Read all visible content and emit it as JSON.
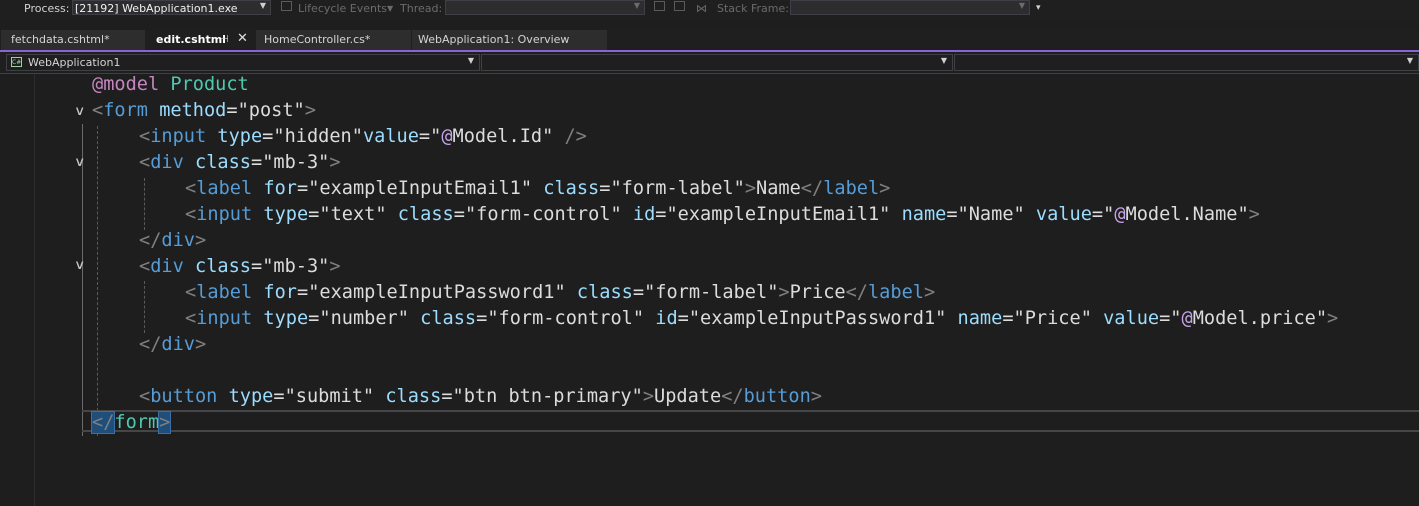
{
  "debug_toolbar": {
    "process_label": "Process:",
    "process_value": "[21192] WebApplication1.exe",
    "lifecycle_label": "Lifecycle Events",
    "thread_label": "Thread:",
    "stack_frame_label": "Stack Frame:"
  },
  "tabs": [
    {
      "label": "fetchdata.cshtml*",
      "active": false
    },
    {
      "label": "edit.cshtml",
      "active": true
    },
    {
      "label": "HomeController.cs*",
      "active": false
    },
    {
      "label": "WebApplication1: Overview",
      "active": false
    }
  ],
  "navbar": {
    "project": "WebApplication1",
    "project_icon": "csharp-project-icon"
  },
  "code": {
    "l1": {
      "dir": "@model",
      "type": "Product"
    },
    "l2": {
      "open": "<",
      "tag": "form",
      "attr": "method",
      "eq": "=",
      "val": "\"post\"",
      "close": ">"
    },
    "l3": {
      "open": "<",
      "tag": "input",
      "a1": "type",
      "eq1": "=",
      "v1": "\"hidden\"",
      "a2": "value",
      "eq2": "=",
      "q": "\"",
      "at": "@",
      "expr": "Model.Id",
      "q2": "\"",
      "close": " />"
    },
    "l4": {
      "open": "<",
      "tag": "div",
      "attr": "class",
      "eq": "=",
      "val": "\"mb-3\"",
      "close": ">"
    },
    "l5": {
      "open": "<",
      "tag": "label",
      "a1": "for",
      "eq1": "=",
      "v1": "\"exampleInputEmail1\"",
      "a2": "class",
      "eq2": "=",
      "v2": "\"form-label\"",
      "gt": ">",
      "text": "Name",
      "lt": "</",
      "ctag": "label",
      "close": ">"
    },
    "l6": {
      "open": "<",
      "tag": "input",
      "a1": "type",
      "eq1": "=",
      "v1": "\"text\"",
      "a2": "class",
      "eq2": "=",
      "v2": "\"form-control\"",
      "a3": "id",
      "eq3": "=",
      "v3": "\"exampleInputEmail1\"",
      "a4": "name",
      "eq4": "=",
      "v4": "\"Name\"",
      "a5": "value",
      "eq5": "=",
      "q": "\"",
      "at": "@",
      "expr": "Model.Name",
      "q2": "\"",
      "close": ">"
    },
    "l7": {
      "open": "</",
      "tag": "div",
      "close": ">"
    },
    "l8": {
      "open": "<",
      "tag": "div",
      "attr": "class",
      "eq": "=",
      "val": "\"mb-3\"",
      "close": ">"
    },
    "l9": {
      "open": "<",
      "tag": "label",
      "a1": "for",
      "eq1": "=",
      "v1": "\"exampleInputPassword1\"",
      "a2": "class",
      "eq2": "=",
      "v2": "\"form-label\"",
      "gt": ">",
      "text": "Price",
      "lt": "</",
      "ctag": "label",
      "close": ">"
    },
    "l10": {
      "open": "<",
      "tag": "input",
      "a1": "type",
      "eq1": "=",
      "v1": "\"number\"",
      "a2": "class",
      "eq2": "=",
      "v2": "\"form-control\"",
      "a3": "id",
      "eq3": "=",
      "v3": "\"exampleInputPassword1\"",
      "a4": "name",
      "eq4": "=",
      "v4": "\"Price\"",
      "a5": "value",
      "eq5": "=",
      "q": "\"",
      "at": "@",
      "expr": "Model.price",
      "q2": "\"",
      "close": ">"
    },
    "l11": {
      "open": "</",
      "tag": "div",
      "close": ">"
    },
    "l13": {
      "open": "<",
      "tag": "button",
      "a1": "type",
      "eq1": "=",
      "v1": "\"submit\"",
      "a2": "class",
      "eq2": "=",
      "v2": "\"btn btn-primary\"",
      "gt": ">",
      "text": "Update",
      "lt": "</",
      "ctag": "button",
      "close": ">"
    },
    "l14": {
      "open": "</",
      "tag": "form",
      "close": ">"
    }
  },
  "colors": {
    "editor_bg": "#1e1e1e",
    "tab_accent": "#8a64d6",
    "tag": "#569cd6",
    "attribute": "#9cdcfe",
    "razor_directive": "#c586c0",
    "type": "#4ec9b0"
  }
}
